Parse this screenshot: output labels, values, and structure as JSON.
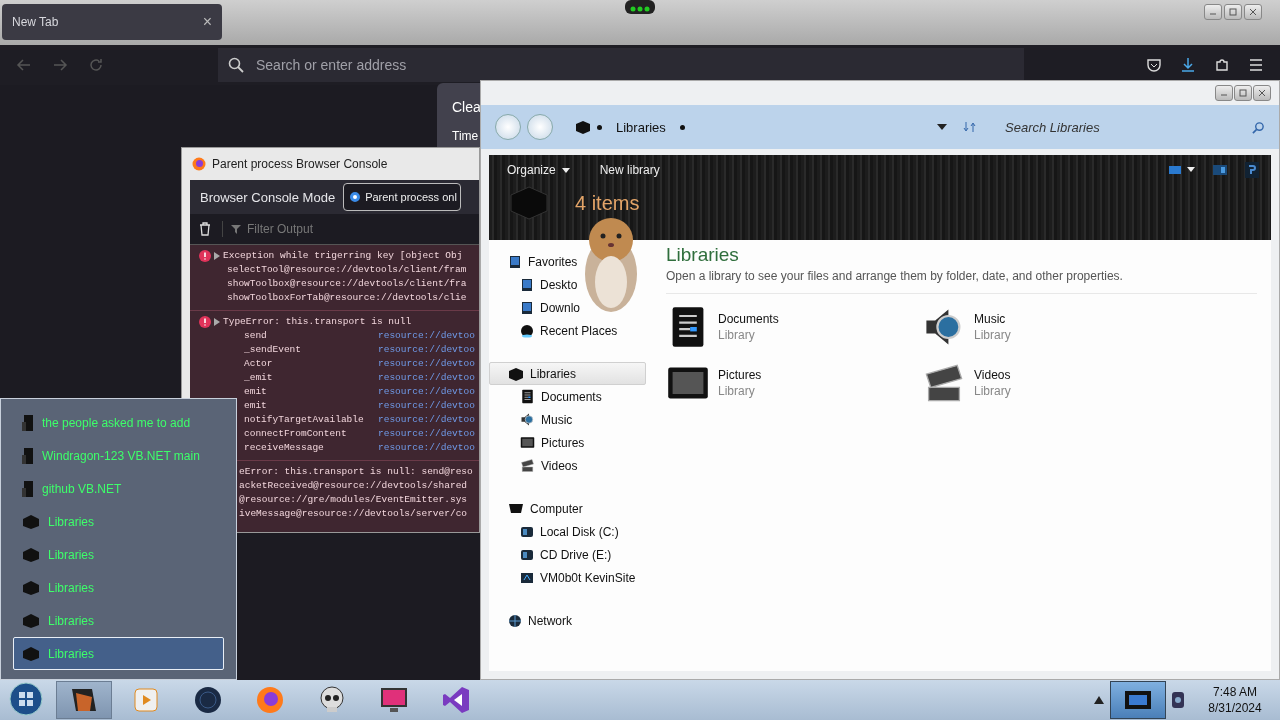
{
  "browser": {
    "tab": {
      "title": "New Tab",
      "close": "×"
    },
    "address": {
      "placeholder": "Search or enter address"
    },
    "dialog": {
      "title": "Clea",
      "label": "Time"
    }
  },
  "console": {
    "title": "Parent process Browser Console",
    "mode_label": "Browser Console Mode",
    "mode_option": {
      "label": "Parent process onl",
      "selected": true
    },
    "filter": {
      "placeholder": "Filter Output"
    },
    "exception": {
      "text": "Exception while trigerring key [object Obj",
      "stack": [
        "selectTool@resource://devtools/client/fram",
        "showToolbox@resource://devtools/client/fra",
        "showToolboxForTab@resource://devtools/clie"
      ]
    },
    "type_error": {
      "text": "TypeError: this.transport is null",
      "frames": [
        {
          "fn": "send",
          "src": "resource://devtoo"
        },
        {
          "fn": "_sendEvent",
          "src": "resource://devtoo"
        },
        {
          "fn": "Actor",
          "src": "resource://devtoo"
        },
        {
          "fn": "_emit",
          "src": "resource://devtoo"
        },
        {
          "fn": "emit",
          "src": "resource://devtoo"
        },
        {
          "fn": "emit",
          "src": "resource://devtoo"
        },
        {
          "fn": "notifyTargetAvailable",
          "src": "resource://devtoo"
        },
        {
          "fn": "connectFromContent",
          "src": "resource://devtoo"
        },
        {
          "fn": "receiveMessage",
          "src": "resource://devtoo"
        }
      ]
    },
    "trailing": [
      "eError: this.transport is null: send@reso",
      "acketReceived@resource://devtools/shared",
      "@resource://gre/modules/EventEmitter.sys",
      "iveMessage@resource://devtools/server/co"
    ]
  },
  "jump_list": [
    {
      "label": "the people asked me to add",
      "kind": "project",
      "selected": false
    },
    {
      "label": "Windragon-123 VB.NET main",
      "kind": "project",
      "selected": false
    },
    {
      "label": "github VB.NET",
      "kind": "project",
      "selected": false
    },
    {
      "label": "Libraries",
      "kind": "library",
      "selected": false
    },
    {
      "label": "Libraries",
      "kind": "library",
      "selected": false
    },
    {
      "label": "Libraries",
      "kind": "library",
      "selected": false
    },
    {
      "label": "Libraries",
      "kind": "library",
      "selected": false
    },
    {
      "label": "Libraries",
      "kind": "library",
      "selected": true
    }
  ],
  "explorer": {
    "address": {
      "crumb": "Libraries"
    },
    "search": {
      "placeholder": "Search Libraries"
    },
    "toolbar": {
      "organize": "Organize",
      "new_library": "New library"
    },
    "header": {
      "count": "4 items"
    },
    "sidebar": [
      {
        "label": "Favorites",
        "kind": "favorites",
        "selected": false,
        "children": [
          {
            "label": "Deskto",
            "kind": "desktop"
          },
          {
            "label": "Downlo",
            "kind": "downloads"
          },
          {
            "label": "Recent Places",
            "kind": "recent"
          }
        ]
      },
      {
        "label": "Libraries",
        "kind": "libraries",
        "selected": true,
        "children": [
          {
            "label": "Documents",
            "kind": "documents"
          },
          {
            "label": "Music",
            "kind": "music"
          },
          {
            "label": "Pictures",
            "kind": "pictures"
          },
          {
            "label": "Videos",
            "kind": "videos"
          }
        ]
      },
      {
        "label": "Computer",
        "kind": "computer",
        "selected": false,
        "children": [
          {
            "label": "Local Disk (C:)",
            "kind": "disk"
          },
          {
            "label": "CD Drive (E:)",
            "kind": "disk"
          },
          {
            "label": "VM0b0t KevinSite",
            "kind": "share"
          }
        ]
      },
      {
        "label": "Network",
        "kind": "network",
        "selected": false
      }
    ],
    "content": {
      "title": "Libraries",
      "subtitle": "Open a library to see your files and arrange them by folder, date, and other properties.",
      "items": [
        {
          "name": "Documents",
          "type": "Library",
          "kind": "documents"
        },
        {
          "name": "Music",
          "type": "Library",
          "kind": "music"
        },
        {
          "name": "Pictures",
          "type": "Library",
          "kind": "pictures"
        },
        {
          "name": "Videos",
          "type": "Library",
          "kind": "videos"
        }
      ]
    }
  },
  "taskbar": {
    "buttons": [
      {
        "kind": "explorer",
        "active": true
      },
      {
        "kind": "media",
        "active": false
      },
      {
        "kind": "globe",
        "active": false
      },
      {
        "kind": "firefox",
        "active": false
      },
      {
        "kind": "skull",
        "active": false
      },
      {
        "kind": "monitor",
        "active": false
      },
      {
        "kind": "studio",
        "active": false
      }
    ],
    "clock": {
      "time": "7:48 AM",
      "date": "8/31/2024"
    }
  }
}
